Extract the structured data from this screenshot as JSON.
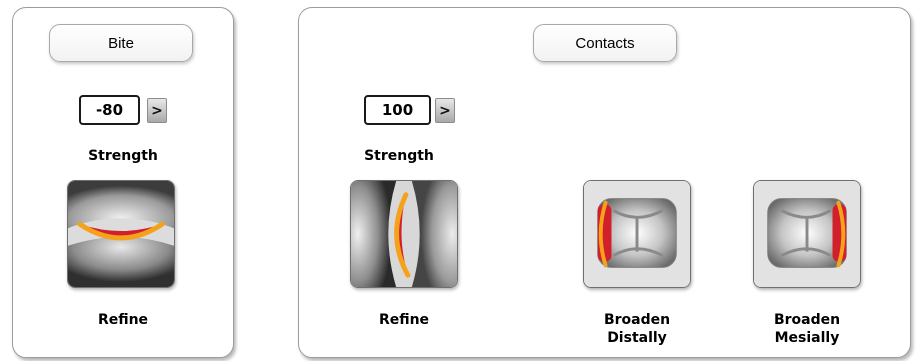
{
  "bite": {
    "title": "Bite",
    "strength_value": "-80",
    "arrow": ">",
    "strength_label": "Strength",
    "refine_label": "Refine"
  },
  "contacts": {
    "title": "Contacts",
    "strength_value": "100",
    "arrow": ">",
    "strength_label": "Strength",
    "refine_label": "Refine",
    "broaden_distally_label": "Broaden\nDistally",
    "broaden_mesially_label": "Broaden\nMesially"
  },
  "colors": {
    "contact_red": "#d11f2b",
    "contact_orange": "#f4a21c"
  },
  "icons": {
    "bite_refine": "bite-refine-icon",
    "contacts_refine": "contacts-refine-icon",
    "broaden_distally": "broaden-distally-icon",
    "broaden_mesially": "broaden-mesially-icon"
  }
}
